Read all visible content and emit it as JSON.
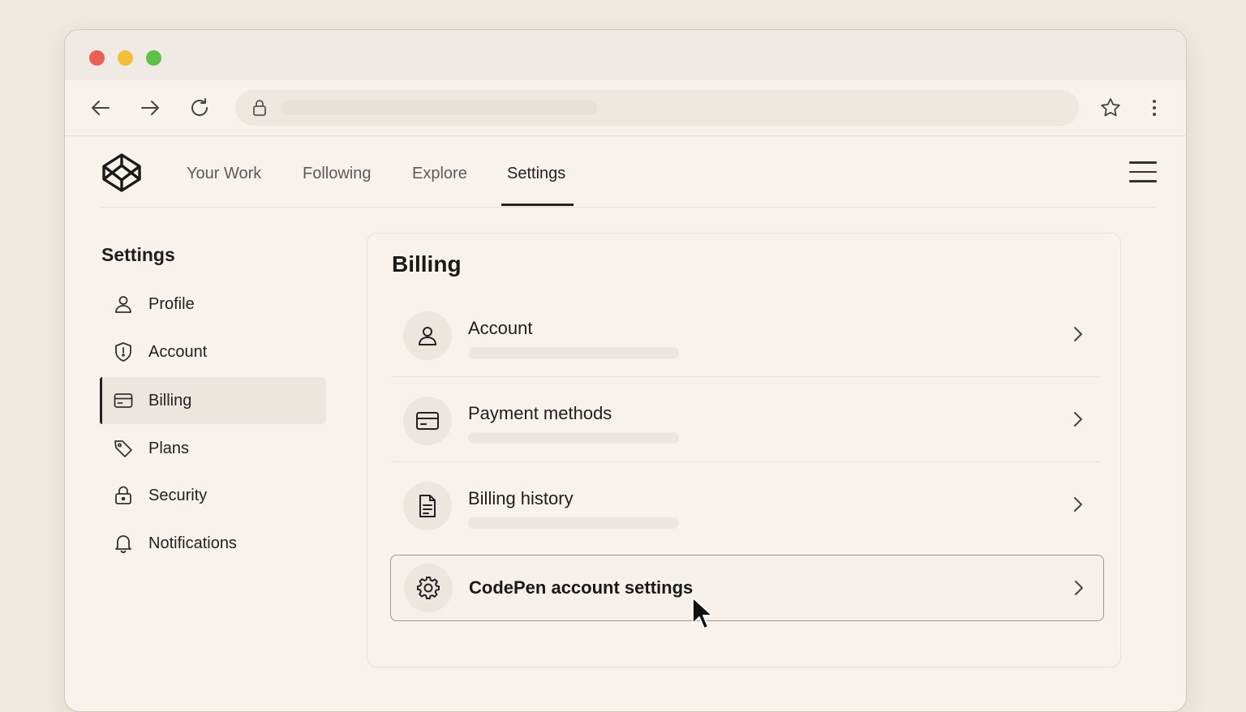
{
  "browser": {
    "window_controls": [
      "close",
      "minimize",
      "maximize"
    ],
    "nav_icons": [
      "back-arrow-icon",
      "forward-arrow-icon",
      "reload-icon"
    ],
    "address_icon": "lock-icon",
    "address_value": "",
    "right_icons": [
      "star-icon",
      "kebab-menu-icon"
    ]
  },
  "header": {
    "logo": "codepen-logo",
    "nav": [
      {
        "label": "Your Work",
        "active": false
      },
      {
        "label": "Following",
        "active": false
      },
      {
        "label": "Explore",
        "active": false
      },
      {
        "label": "Settings",
        "active": true
      }
    ],
    "menu_icon": "hamburger-icon"
  },
  "sidebar": {
    "title": "Settings",
    "items": [
      {
        "label": "Profile",
        "icon": "person-icon",
        "active": false
      },
      {
        "label": "Account",
        "icon": "shield-icon",
        "active": false
      },
      {
        "label": "Billing",
        "icon": "credit-card-icon",
        "active": true
      },
      {
        "label": "Plans",
        "icon": "tag-icon",
        "active": false
      },
      {
        "label": "Security",
        "icon": "lock-icon",
        "active": false
      },
      {
        "label": "Notifications",
        "icon": "bell-icon",
        "active": false
      }
    ]
  },
  "main": {
    "title": "Billing",
    "rows": [
      {
        "label": "Account",
        "icon": "person-icon"
      },
      {
        "label": "Payment methods",
        "icon": "credit-card-icon"
      },
      {
        "label": "Billing history",
        "icon": "document-icon"
      },
      {
        "label": "CodePen account settings",
        "icon": "gear-icon",
        "highlighted": true
      }
    ]
  },
  "colors": {
    "background": "#efe9df",
    "window": "#f7f3ec",
    "close": "#ec5f55",
    "minimize": "#f4bd3b",
    "maximize": "#5fc049",
    "active_bg": "#ebe6de",
    "text": "#1c1c1c"
  }
}
